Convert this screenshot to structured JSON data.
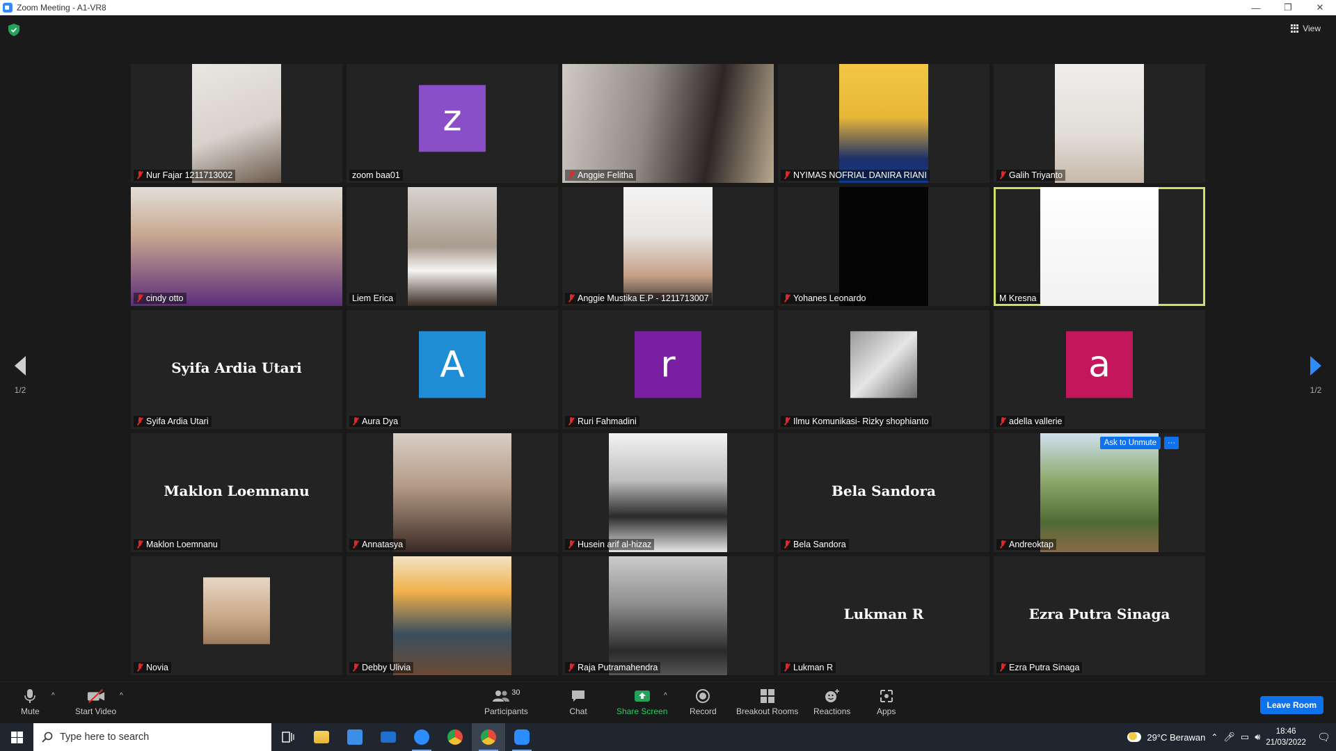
{
  "window": {
    "title": "Zoom Meeting - A1-VR8",
    "minimize": "—",
    "maximize": "❐",
    "close": "✕"
  },
  "view": {
    "label": "View"
  },
  "pagination": {
    "left": "1/2",
    "right": "1/2"
  },
  "colors": {
    "tile_bg": "#232323",
    "active_speaker": "#c9e265",
    "zoom_blue": "#0e72ed",
    "muted_red": "#e02828"
  },
  "participants": [
    {
      "name": "Nur Fajar 1211713002",
      "muted": true,
      "kind": "video",
      "bg": "linear-gradient(160deg,#e9e6e2 0%,#d8d2cc 55%,#6b5a4c 100%)"
    },
    {
      "name": "zoom baa01",
      "muted": false,
      "kind": "avatar",
      "initial": "z",
      "color": "#8a4ec8"
    },
    {
      "name": "Anggie Felitha",
      "muted": true,
      "kind": "video-wide",
      "bg": "linear-gradient(100deg,#cfcac4 0%,#8f8a84 40%,#2c2726 70%,#b9a88e 100%)"
    },
    {
      "name": "NYIMAS NOFRIAL DANIRA RIANI",
      "muted": true,
      "kind": "video",
      "bg": "linear-gradient(180deg,#f2c744 0%,#e8b638 45%,#1c2f6a 80%,#123a8a 100%)"
    },
    {
      "name": "Galih Triyanto",
      "muted": true,
      "kind": "video",
      "bg": "linear-gradient(180deg,#f0eeec 0%,#e2ddd8 60%,#c7b8a9 100%)"
    },
    {
      "name": "cindy otto",
      "muted": true,
      "kind": "video-wide",
      "bg": "linear-gradient(180deg,#e3ded8 0%,#c9a890 40%,#5c2e7a 100%)"
    },
    {
      "name": "Liem Erica",
      "muted": false,
      "kind": "video",
      "bg": "linear-gradient(180deg,#d9d4cf 0%,#a99b8e 50%,#f5f5f3 70%,#3b2d25 100%)"
    },
    {
      "name": "Anggie Mustika E.P - 1211713007",
      "muted": true,
      "kind": "video",
      "bg": "linear-gradient(180deg,#f4f4f4 0%,#e7e4e2 40%,#c49f86 75%,#2a2a2a 100%)"
    },
    {
      "name": "Yohanes Leonardo",
      "muted": true,
      "kind": "video",
      "bg": "#050505"
    },
    {
      "name": "M Kresna",
      "muted": false,
      "kind": "video-w170",
      "bg": "linear-gradient(180deg,#ffffff 0%,#f2f2f2 100%)",
      "active": true
    },
    {
      "name": "Syifa Ardia Utari",
      "muted": true,
      "kind": "name"
    },
    {
      "name": "Aura Dya",
      "muted": true,
      "kind": "avatar",
      "initial": "A",
      "color": "#1f8dd6"
    },
    {
      "name": "Ruri Fahmadini",
      "muted": true,
      "kind": "avatar",
      "initial": "r",
      "color": "#7b1fa2"
    },
    {
      "name": "Ilmu Komunikasi- Rizky shophianto",
      "muted": true,
      "kind": "photo",
      "bg": "linear-gradient(135deg,#9a9a9a 0%,#e6e6e6 50%,#6a6a6a 100%)"
    },
    {
      "name": "adella vallerie",
      "muted": true,
      "kind": "avatar",
      "initial": "a",
      "color": "#c2185b"
    },
    {
      "name": "Maklon Loemnanu",
      "muted": true,
      "kind": "name"
    },
    {
      "name": "Annatasya",
      "muted": true,
      "kind": "video-w170",
      "bg": "linear-gradient(180deg,#d8cfc6 0%,#b49a85 45%,#3a2a24 100%)"
    },
    {
      "name": "Husein arif al-hizaz",
      "muted": true,
      "kind": "video-w170",
      "bg": "linear-gradient(180deg,#f3f3f3 0%,#bdbdbd 40%,#2a2a2a 70%,#e5e5e5 100%)"
    },
    {
      "name": "Bela Sandora",
      "muted": true,
      "kind": "name"
    },
    {
      "name": "Andreoktap",
      "muted": true,
      "kind": "video-w170",
      "bg": "linear-gradient(180deg,#cfe0ef 0%,#8da86a 40%,#4f6b34 75%,#8a6a4a 100%)",
      "ask_unmute": true
    },
    {
      "name": "Novia",
      "muted": true,
      "kind": "photo",
      "bg": "linear-gradient(180deg,#e7d6c5 0%,#c9a887 60%,#9c7a5c 100%)"
    },
    {
      "name": "Debby Ulivia",
      "muted": true,
      "kind": "video-w170",
      "bg": "linear-gradient(180deg,#f3e2c2 0%,#f0b04a 30%,#3b4f5e 65%,#6a4a36 100%)"
    },
    {
      "name": "Raja Putramahendra",
      "muted": true,
      "kind": "video-w170",
      "bg": "linear-gradient(180deg,#cbcbcb 0%,#8f8f8f 40%,#2a2a2a 80%,#555 100%)"
    },
    {
      "name": "Lukman R",
      "muted": true,
      "kind": "name"
    },
    {
      "name": "Ezra Putra Sinaga",
      "muted": true,
      "kind": "name"
    }
  ],
  "ask_unmute_label": "Ask to Unmute",
  "more_label": "···",
  "toolbar": {
    "mute": "Mute",
    "start_video": "Start Video",
    "participants": "Participants",
    "participant_count": "30",
    "chat": "Chat",
    "share_screen": "Share Screen",
    "record": "Record",
    "breakout_rooms": "Breakout Rooms",
    "reactions": "Reactions",
    "apps": "Apps",
    "leave": "Leave Room"
  },
  "taskbar": {
    "search_placeholder": "Type here to search",
    "weather": "29°C  Berawan",
    "time": "18:46",
    "date": "21/03/2022"
  }
}
